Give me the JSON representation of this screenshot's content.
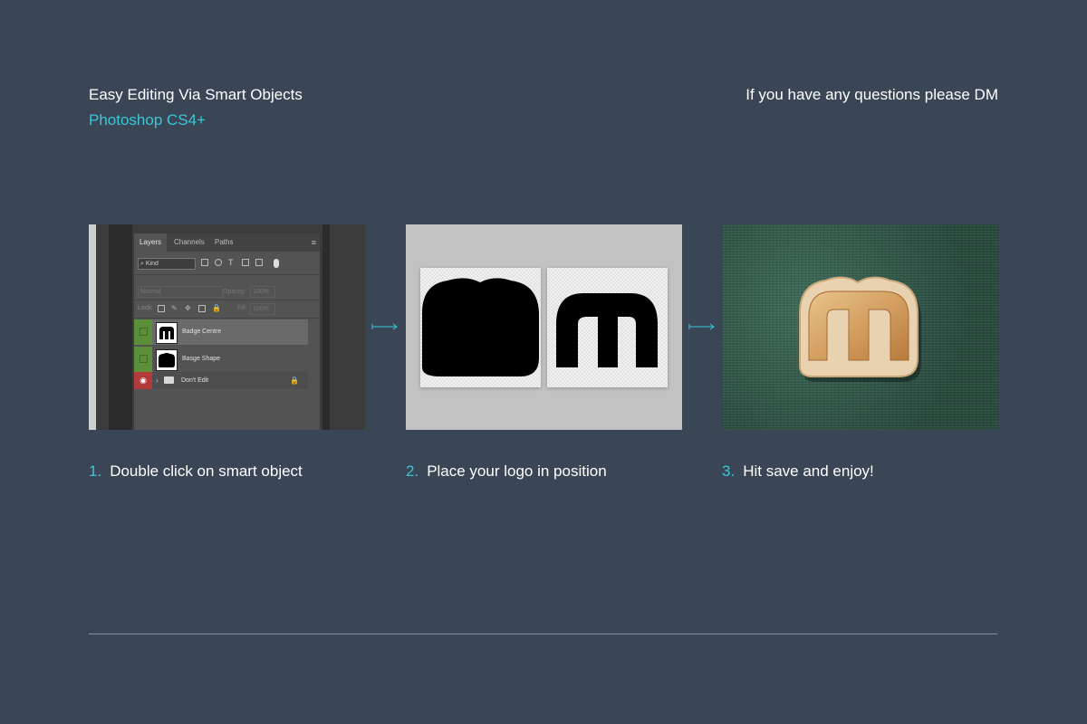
{
  "header": {
    "title": "Easy Editing Via Smart Objects",
    "subtitle": "Photoshop CS4+",
    "contact": "If you have any questions please DM"
  },
  "colors": {
    "background": "#3a4556",
    "accent": "#3cc6d6",
    "text": "#ffffff",
    "divider": "#8391a3"
  },
  "panel1": {
    "tabs": [
      "Layers",
      "Channels",
      "Paths"
    ],
    "filter_kind": "Kind",
    "blend_mode": "Normal",
    "opacity_label": "Opacity:",
    "opacity_value": "100%",
    "lock_label": "Lock:",
    "fill_label": "Fill:",
    "fill_value": "100%",
    "layers": [
      {
        "name": "Badge Centre"
      },
      {
        "name": "Basge Shape"
      }
    ],
    "group": {
      "name": "Don't Edit"
    }
  },
  "steps": [
    {
      "number": "1.",
      "text": "Double click on smart object"
    },
    {
      "number": "2.",
      "text": "Place your logo in position"
    },
    {
      "number": "3.",
      "text": "Hit save and enjoy!"
    }
  ],
  "icons": {
    "arrow": "arrow-right-icon",
    "eye": "eye-icon",
    "folder": "folder-icon",
    "lock": "lock-icon"
  }
}
